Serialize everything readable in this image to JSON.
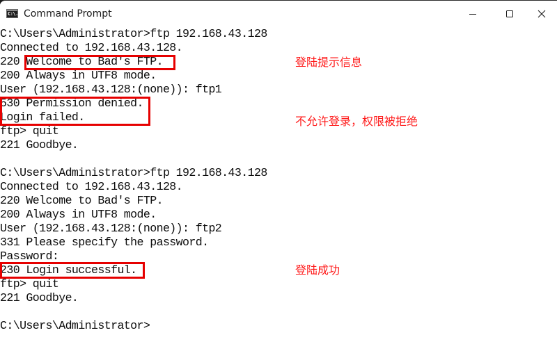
{
  "window": {
    "title": "Command Prompt",
    "icon": "console-icon",
    "icon_text": "C:\\.",
    "controls": {
      "minimize_icon": "minimize-icon",
      "maximize_icon": "maximize-icon",
      "close_icon": "close-icon"
    }
  },
  "terminal": {
    "lines": [
      "C:\\Users\\Administrator>ftp 192.168.43.128",
      "Connected to 192.168.43.128.",
      "220 Welcome to Bad's FTP.",
      "200 Always in UTF8 mode.",
      "User (192.168.43.128:(none)): ftp1",
      "530 Permission denied.",
      "Login failed.",
      "ftp> quit",
      "221 Goodbye.",
      "",
      "C:\\Users\\Administrator>ftp 192.168.43.128",
      "Connected to 192.168.43.128.",
      "220 Welcome to Bad's FTP.",
      "200 Always in UTF8 mode.",
      "User (192.168.43.128:(none)): ftp2",
      "331 Please specify the password.",
      "Password:",
      "230 Login successful.",
      "ftp> quit",
      "221 Goodbye.",
      "",
      "C:\\Users\\Administrator>"
    ]
  },
  "annotations": {
    "highlight_color": "#e60000",
    "text_color": "#ff1a1a",
    "notes": [
      {
        "text": "登陆提示信息",
        "target": "220 Welcome to Bad's FTP."
      },
      {
        "text": "不允许登录，权限被拒绝",
        "target": "530 Permission denied. / Login failed."
      },
      {
        "text": "登陆成功",
        "target": "230 Login successful."
      }
    ]
  }
}
